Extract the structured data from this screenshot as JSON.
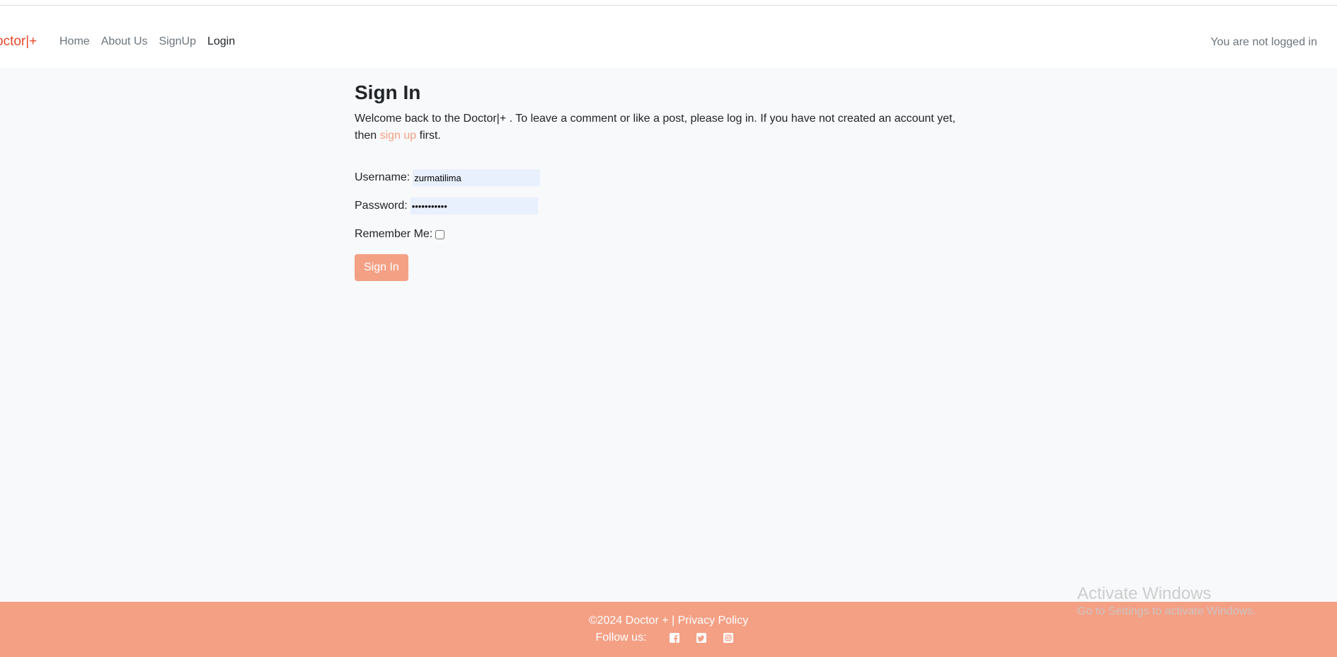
{
  "navbar": {
    "brand": "octor|+",
    "links": [
      {
        "label": "Home",
        "active": false
      },
      {
        "label": "About Us",
        "active": false
      },
      {
        "label": "SignUp",
        "active": false
      },
      {
        "label": "Login",
        "active": true
      }
    ],
    "status": "You are not logged in"
  },
  "main": {
    "title": "Sign In",
    "intro_before": "Welcome back to the Doctor|+ . To leave a comment or like a post, please log in. If you have not created an account yet, then ",
    "intro_link": "sign up",
    "intro_after": " first.",
    "form": {
      "username_label": "Username:",
      "username_value": "zurmatilima",
      "password_label": "Password:",
      "password_value": "•••••••••••",
      "remember_label": "Remember Me:",
      "remember_checked": false,
      "submit_label": "Sign In"
    }
  },
  "footer": {
    "copyright": "©2024 Doctor + | ",
    "privacy_label": "Privacy Policy",
    "follow_label": "Follow us:",
    "social_icons": [
      "facebook-icon",
      "twitter-icon",
      "instagram-icon"
    ]
  },
  "watermark": {
    "line1": "Activate Windows",
    "line2": "Go to Settings to activate Windows."
  },
  "colors": {
    "brand": "#e8472b",
    "accent": "#f4a085",
    "background": "#f8f9fa",
    "input_autofill": "#e8f0fe"
  }
}
